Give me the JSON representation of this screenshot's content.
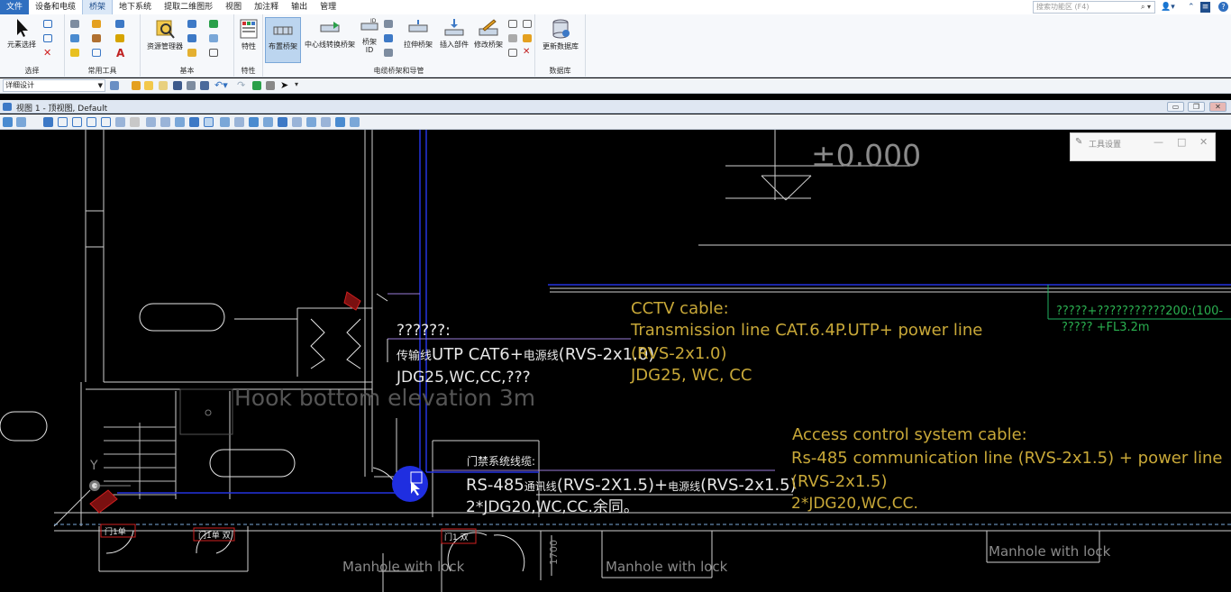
{
  "menubar": {
    "tabs": [
      "文件",
      "设备和电缆",
      "桥架",
      "地下系统",
      "提取二维图形",
      "视图",
      "加注释",
      "输出",
      "管理"
    ],
    "active_tab": "桥架",
    "search_placeholder": "搜索功能区 (F4)"
  },
  "ribbon": {
    "groups": {
      "select": "选择",
      "common": "常用工具",
      "basic": "基本",
      "props": "特性",
      "cable": "电缆桥架和导管",
      "db": "数据库"
    },
    "buttons": {
      "element_select": "元素选择",
      "resource_manager": "资源管理器",
      "properties": "特性",
      "layout_tray": "布置桥架",
      "centerline_tray": "中心线转换桥架",
      "tray_id_1": "桥架",
      "tray_id_2": "ID",
      "stretch_tray": "拉伸桥架",
      "insert_part": "插入部件",
      "modify_tray": "修改桥架",
      "update_db": "更新数据库"
    }
  },
  "quickbar": {
    "design_mode": "详细设计"
  },
  "view": {
    "title": "视图 1 - 顶视图, Default"
  },
  "toolpanel": {
    "title": "工具设置"
  },
  "drawing": {
    "elevation": "±0.000",
    "hook_note": "Hook bottom elevation 3m",
    "cn_title": "??????:",
    "cn_line1_a": "传输线",
    "cn_line1_b": "UTP CAT6+",
    "cn_line1_c": "电源线",
    "cn_line1_d": "(RVS-2x1.0)",
    "cn_line2": "JDG25,WC,CC,???",
    "cctv_title": "CCTV   cable:",
    "cctv_line1": "Transmission line CAT.6.4P.UTP+ power line",
    "cctv_line2": "(RVS-2x1.0)",
    "cctv_line3": "JDG25, WC, CC",
    "green_line1": "?????+???????????200:(100-",
    "green_line2": "????? +FL3.2m",
    "door_title": "门禁系统线缆:",
    "door_line1_a": "RS-485",
    "door_line1_b": "通讯线",
    "door_line1_c": "(RVS-2X1.5)+",
    "door_line1_d": "电源线",
    "door_line1_e": "(RVS-2x1.5)",
    "door_line2": "2*JDG20,WC,CC.余同。",
    "access_title": "Access control system cable:",
    "access_line1": "Rs-485 communication line (RVS-2x1.5) + power line",
    "access_line2": "(RVS-2x1.5)",
    "access_line3": "2*JDG20,WC,CC.",
    "manhole1": "Manhole with lock",
    "manhole2": "Manhole with lock",
    "manhole3": "Manhole with lock",
    "dim_1700": "1700",
    "axis_y": "Y",
    "door_tag1": "门1单",
    "door_tag2": "门1单 双",
    "door_tag3": "门1 双"
  }
}
